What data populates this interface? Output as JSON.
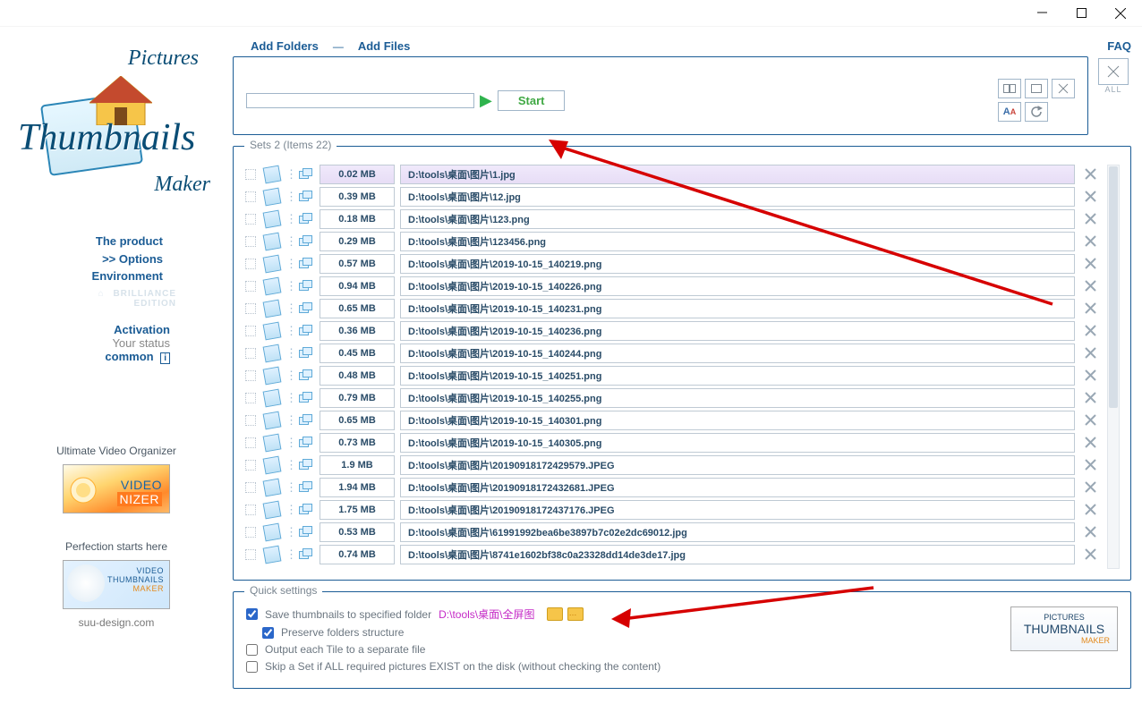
{
  "window": {
    "faq": "FAQ",
    "all_label": "ALL"
  },
  "logo": {
    "line1": "Pictures",
    "line2": "Thumbnails",
    "line3": "Maker"
  },
  "left_links": {
    "product": "The product",
    "options": ">> Options",
    "environment": "Environment",
    "edition1": "BRILLIANCE",
    "edition2": "EDITION",
    "activation": "Activation",
    "your_status": "Your status",
    "common": "common",
    "i": "i"
  },
  "promo": {
    "video_org_label": "Ultimate Video Organizer",
    "perfection_label": "Perfection starts here",
    "videonizer": "VIDEO",
    "videonizer2": "NIZER",
    "ptm_small1": "VIDEO",
    "ptm_small2": "THUMBNAILS",
    "ptm_small3": "MAKER",
    "site": "suu-design.com",
    "right_small": "PICTURES",
    "right_big": "THUMBNAILS",
    "right_sub": "MAKER"
  },
  "top_links": {
    "add_folders": "Add Folders",
    "add_files": "Add Files",
    "start": "Start"
  },
  "list": {
    "legend": "Sets 2 (Items 22)",
    "rows": [
      {
        "size": "0.02 MB",
        "path": "D:\\tools\\桌面\\图片\\1.jpg",
        "selected": true
      },
      {
        "size": "0.39 MB",
        "path": "D:\\tools\\桌面\\图片\\12.jpg"
      },
      {
        "size": "0.18 MB",
        "path": "D:\\tools\\桌面\\图片\\123.png"
      },
      {
        "size": "0.29 MB",
        "path": "D:\\tools\\桌面\\图片\\123456.png"
      },
      {
        "size": "0.57 MB",
        "path": "D:\\tools\\桌面\\图片\\2019-10-15_140219.png"
      },
      {
        "size": "0.94 MB",
        "path": "D:\\tools\\桌面\\图片\\2019-10-15_140226.png"
      },
      {
        "size": "0.65 MB",
        "path": "D:\\tools\\桌面\\图片\\2019-10-15_140231.png"
      },
      {
        "size": "0.36 MB",
        "path": "D:\\tools\\桌面\\图片\\2019-10-15_140236.png"
      },
      {
        "size": "0.45 MB",
        "path": "D:\\tools\\桌面\\图片\\2019-10-15_140244.png"
      },
      {
        "size": "0.48 MB",
        "path": "D:\\tools\\桌面\\图片\\2019-10-15_140251.png"
      },
      {
        "size": "0.79 MB",
        "path": "D:\\tools\\桌面\\图片\\2019-10-15_140255.png"
      },
      {
        "size": "0.65 MB",
        "path": "D:\\tools\\桌面\\图片\\2019-10-15_140301.png"
      },
      {
        "size": "0.73 MB",
        "path": "D:\\tools\\桌面\\图片\\2019-10-15_140305.png"
      },
      {
        "size": "1.9 MB",
        "path": "D:\\tools\\桌面\\图片\\20190918172429579.JPEG"
      },
      {
        "size": "1.94 MB",
        "path": "D:\\tools\\桌面\\图片\\20190918172432681.JPEG"
      },
      {
        "size": "1.75 MB",
        "path": "D:\\tools\\桌面\\图片\\20190918172437176.JPEG"
      },
      {
        "size": "0.53 MB",
        "path": "D:\\tools\\桌面\\图片\\61991992bea6be3897b7c02e2dc69012.jpg"
      },
      {
        "size": "0.74 MB",
        "path": "D:\\tools\\桌面\\图片\\8741e1602bf38c0a23328dd14de3de17.jpg"
      }
    ]
  },
  "quick": {
    "legend": "Quick settings",
    "save_label": "Save thumbnails to specified folder",
    "save_path": "D:\\tools\\桌面\\全屏图",
    "preserve": "Preserve folders structure",
    "output_tile": "Output each Tile to a separate file",
    "skip_set": "Skip a Set if ALL required pictures EXIST on the disk (without checking the content)"
  }
}
